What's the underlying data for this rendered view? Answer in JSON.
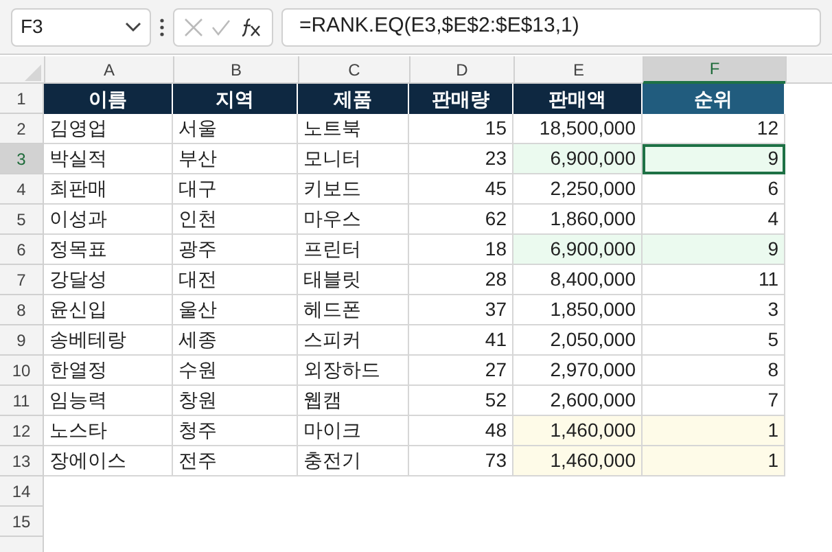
{
  "name_box": {
    "value": "F3"
  },
  "formula_bar": {
    "value": "=RANK.EQ(E3,$E$2:$E$13,1)"
  },
  "columns": [
    {
      "label": "A",
      "selected": false
    },
    {
      "label": "B",
      "selected": false
    },
    {
      "label": "C",
      "selected": false
    },
    {
      "label": "D",
      "selected": false
    },
    {
      "label": "E",
      "selected": false
    },
    {
      "label": "F",
      "selected": true
    }
  ],
  "header_row": {
    "number": "1",
    "cells": [
      {
        "text": "이름",
        "color": "#0e2841"
      },
      {
        "text": "지역",
        "color": "#0e2841"
      },
      {
        "text": "제품",
        "color": "#0e2841"
      },
      {
        "text": "판매량",
        "color": "#0e2841"
      },
      {
        "text": "판매액",
        "color": "#0e2841"
      },
      {
        "text": "순위",
        "color": "#215c7e"
      }
    ]
  },
  "rows": [
    {
      "number": "2",
      "selected": false,
      "cells": [
        "김영업",
        "서울",
        "노트북",
        "15",
        "18,500,000",
        "12"
      ]
    },
    {
      "number": "3",
      "selected": true,
      "color": "#ebfaef",
      "cells": [
        "박실적",
        "부산",
        "모니터",
        "23",
        "6,900,000",
        "9"
      ]
    },
    {
      "number": "4",
      "selected": false,
      "cells": [
        "최판매",
        "대구",
        "키보드",
        "45",
        "2,250,000",
        "6"
      ]
    },
    {
      "number": "5",
      "selected": false,
      "cells": [
        "이성과",
        "인천",
        "마우스",
        "62",
        "1,860,000",
        "4"
      ]
    },
    {
      "number": "6",
      "selected": false,
      "color": "#ebfaef",
      "cells": [
        "정목표",
        "광주",
        "프린터",
        "18",
        "6,900,000",
        "9"
      ]
    },
    {
      "number": "7",
      "selected": false,
      "cells": [
        "강달성",
        "대전",
        "태블릿",
        "28",
        "8,400,000",
        "11"
      ]
    },
    {
      "number": "8",
      "selected": false,
      "cells": [
        "윤신입",
        "울산",
        "헤드폰",
        "37",
        "1,850,000",
        "3"
      ]
    },
    {
      "number": "9",
      "selected": false,
      "cells": [
        "송베테랑",
        "세종",
        "스피커",
        "41",
        "2,050,000",
        "5"
      ]
    },
    {
      "number": "10",
      "selected": false,
      "cells": [
        "한열정",
        "수원",
        "외장하드",
        "27",
        "2,970,000",
        "8"
      ]
    },
    {
      "number": "11",
      "selected": false,
      "cells": [
        "임능력",
        "창원",
        "웹캠",
        "52",
        "2,600,000",
        "7"
      ]
    },
    {
      "number": "12",
      "selected": false,
      "color": "#fefbe8",
      "cells": [
        "노스타",
        "청주",
        "마이크",
        "48",
        "1,460,000",
        "1"
      ]
    },
    {
      "number": "13",
      "selected": false,
      "color": "#fefbe8",
      "cells": [
        "장에이스",
        "전주",
        "충전기",
        "73",
        "1,460,000",
        "1"
      ]
    }
  ],
  "empty_rows": [
    "14",
    "15"
  ]
}
